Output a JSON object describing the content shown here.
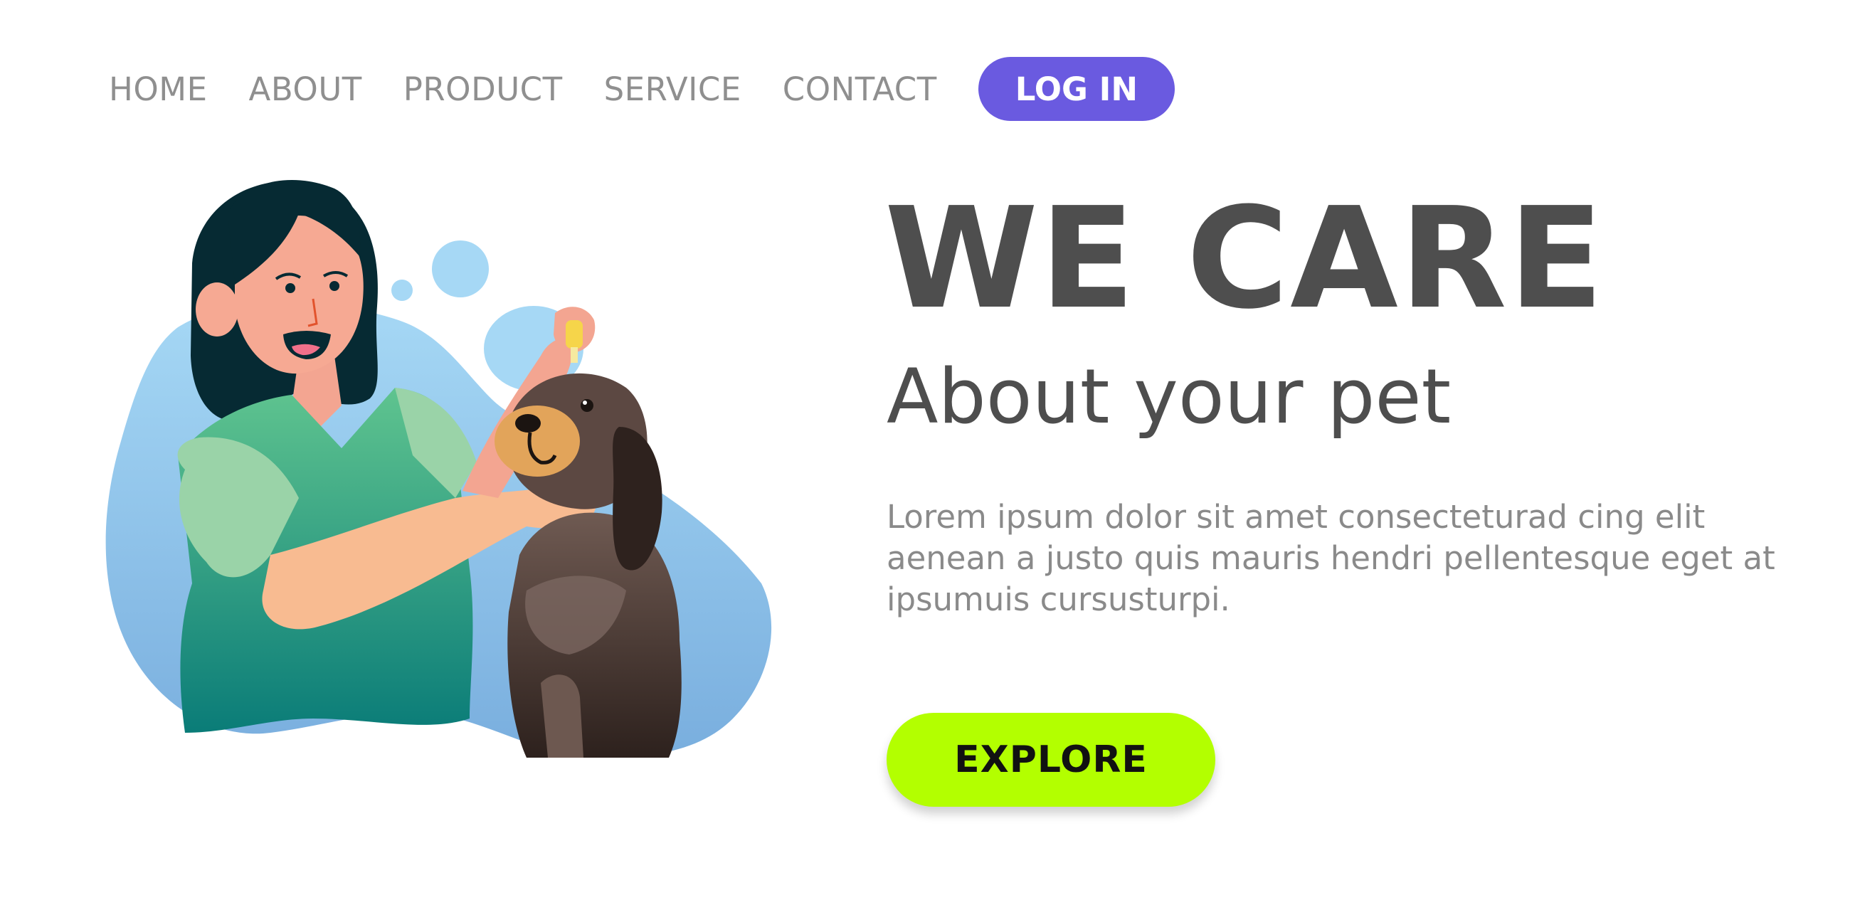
{
  "nav": {
    "items": [
      {
        "label": "HOME"
      },
      {
        "label": "ABOUT"
      },
      {
        "label": "PRODUCT"
      },
      {
        "label": "SERVICE"
      },
      {
        "label": "CONTACT"
      }
    ],
    "login_label": "LOG IN"
  },
  "hero": {
    "title": "WE CARE",
    "subtitle": "About your pet",
    "body": "Lorem ipsum dolor sit amet consecteturad cing elit aenean a justo quis mauris hendri pellentesque eget at ipsumuis cursusturpi.",
    "cta_label": "EXPLORE"
  },
  "illustration": {
    "description_icon": "vet-giving-dog-eye-drops-illustration"
  },
  "colors": {
    "accent_purple": "#6a5ae0",
    "accent_lime": "#b3ff00",
    "heading_text": "#4e4e4e",
    "nav_text": "#8f8f8f",
    "blob_blue": "#8ec9f0"
  }
}
